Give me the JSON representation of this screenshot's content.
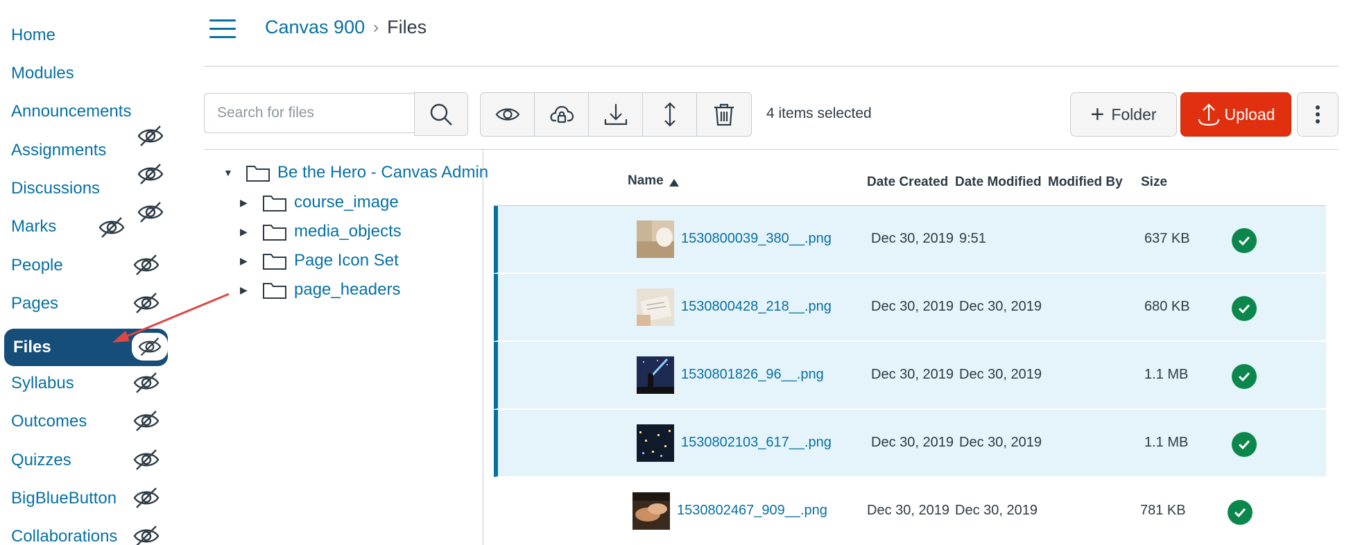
{
  "course_nav": {
    "items": [
      {
        "label": "Home",
        "hidden": false
      },
      {
        "label": "Modules",
        "hidden": false
      },
      {
        "label": "Announcements",
        "hidden": false
      },
      {
        "label": "Assignments",
        "hidden": true
      },
      {
        "label": "Discussions",
        "hidden": true
      },
      {
        "label": "Marks",
        "hidden": true
      },
      {
        "label": "People",
        "hidden": true
      },
      {
        "label": "Pages",
        "hidden": true
      },
      {
        "label": "Files",
        "hidden": true,
        "active": true
      },
      {
        "label": "Syllabus",
        "hidden": true
      },
      {
        "label": "Outcomes",
        "hidden": true
      },
      {
        "label": "Quizzes",
        "hidden": true
      },
      {
        "label": "BigBlueButton",
        "hidden": true
      },
      {
        "label": "Collaborations",
        "hidden": true
      }
    ],
    "hidden_icon": "eye-slash-icon"
  },
  "header": {
    "menu_icon": "hamburger-icon",
    "breadcrumb": {
      "course": "Canvas 900",
      "separator": "›",
      "current": "Files"
    }
  },
  "toolbar": {
    "search_placeholder": "Search for files",
    "search_icon": "search-icon",
    "actions": [
      {
        "name": "view",
        "icon": "eye-icon"
      },
      {
        "name": "restrict-access",
        "icon": "cloud-lock-icon"
      },
      {
        "name": "download",
        "icon": "download-icon"
      },
      {
        "name": "move",
        "icon": "move-icon"
      },
      {
        "name": "delete",
        "icon": "trash-icon"
      }
    ],
    "selected_count": "4 items selected",
    "folder_label": "Folder",
    "upload_label": "Upload",
    "more_icon": "more-vertical-icon"
  },
  "folder_tree": {
    "root": {
      "label": "Be the Hero - Canvas Admin",
      "expanded": true
    },
    "children": [
      {
        "label": "course_image"
      },
      {
        "label": "media_objects"
      },
      {
        "label": "Page Icon Set"
      },
      {
        "label": "page_headers"
      }
    ]
  },
  "files_table": {
    "columns": {
      "name": "Name",
      "date_created": "Date Created",
      "date_modified": "Date Modified",
      "modified_by": "Modified By",
      "size": "Size"
    },
    "sort": {
      "column": "Name",
      "direction": "ascending"
    },
    "rows": [
      {
        "name": "1530800039_380__.png",
        "date_created": "Dec 30, 2019",
        "date_modified": "9:51",
        "modified_by": "",
        "size": "637 KB",
        "selected": true,
        "published": true
      },
      {
        "name": "1530800428_218__.png",
        "date_created": "Dec 30, 2019",
        "date_modified": "Dec 30, 2019",
        "modified_by": "",
        "size": "680 KB",
        "selected": true,
        "published": true
      },
      {
        "name": "1530801826_96__.png",
        "date_created": "Dec 30, 2019",
        "date_modified": "Dec 30, 2019",
        "modified_by": "",
        "size": "1.1 MB",
        "selected": true,
        "published": true
      },
      {
        "name": "1530802103_617__.png",
        "date_created": "Dec 30, 2019",
        "date_modified": "Dec 30, 2019",
        "modified_by": "",
        "size": "1.1 MB",
        "selected": true,
        "published": true
      },
      {
        "name": "1530802467_909__.png",
        "date_created": "Dec 30, 2019",
        "date_modified": "Dec 30, 2019",
        "modified_by": "",
        "size": "781 KB",
        "selected": false,
        "published": true
      }
    ]
  },
  "colors": {
    "link": "#0770a3",
    "active_nav": "#164e7a",
    "upload": "#e1300f",
    "selected_row": "#e5f3fa",
    "published": "#0b874b",
    "annotation_arrow": "#e04545"
  }
}
